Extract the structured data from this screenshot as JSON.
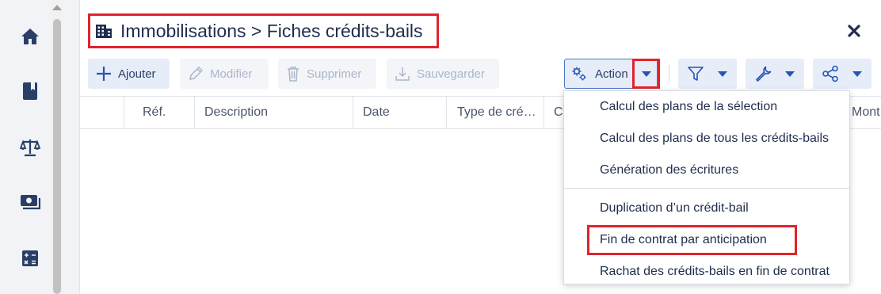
{
  "nav": {
    "items": [
      {
        "icon": "home-icon"
      },
      {
        "icon": "book-icon"
      },
      {
        "icon": "balance-scale-icon"
      },
      {
        "icon": "money-icon"
      },
      {
        "icon": "calculator-icon"
      }
    ]
  },
  "header": {
    "title": "Immobilisations > Fiches crédits-bails",
    "title_icon": "building-icon",
    "close_icon": "close-icon"
  },
  "toolbar": {
    "add_label": "Ajouter",
    "edit_label": "Modifier",
    "delete_label": "Supprimer",
    "save_label": "Sauvegarder",
    "action_label": "Action",
    "filter_icon": "filter-icon",
    "tools_icon": "wrench-icon",
    "share_icon": "share-icon"
  },
  "table": {
    "columns": [
      "Réf.",
      "Description",
      "Date",
      "Type de cré…",
      "C",
      "Mont"
    ]
  },
  "action_menu": {
    "group1": [
      "Calcul des plans de la sélection",
      "Calcul des plans de tous les crédits-bails",
      "Génération des écritures"
    ],
    "group2": [
      "Duplication d’un crédit-bail",
      "Fin de contrat par anticipation",
      "Rachat des crédits-bails en fin de contrat"
    ]
  },
  "colors": {
    "highlight": "#e0242c",
    "accent": "#2553b8",
    "text": "#1f2d4e"
  }
}
